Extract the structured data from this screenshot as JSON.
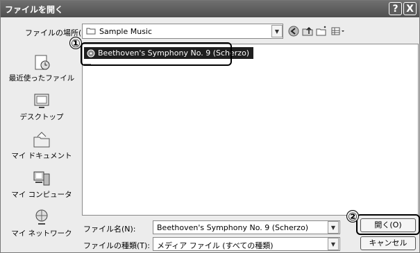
{
  "window": {
    "title": "ファイルを開く",
    "help_button": "?",
    "close_button": "X"
  },
  "location": {
    "label": "ファイルの場所(I):",
    "value": "Sample Music"
  },
  "places": [
    {
      "label": "最近使ったファイル",
      "icon": "recent-documents-icon"
    },
    {
      "label": "デスクトップ",
      "icon": "desktop-icon"
    },
    {
      "label": "マイ ドキュメント",
      "icon": "my-documents-icon"
    },
    {
      "label": "マイ コンピュータ",
      "icon": "my-computer-icon"
    },
    {
      "label": "マイ ネットワーク",
      "icon": "my-network-icon"
    }
  ],
  "files": [
    {
      "name": "Beethoven's Symphony No. 9 (Scherzo)",
      "selected": true
    }
  ],
  "filename": {
    "label": "ファイル名(N):",
    "value": "Beethoven's Symphony No. 9 (Scherzo)"
  },
  "filetype": {
    "label": "ファイルの種類(T):",
    "value": "メディア ファイル (すべての種類)"
  },
  "buttons": {
    "open": "開く(O)",
    "cancel": "キャンセル"
  },
  "callouts": {
    "one": "①",
    "two": "②"
  }
}
